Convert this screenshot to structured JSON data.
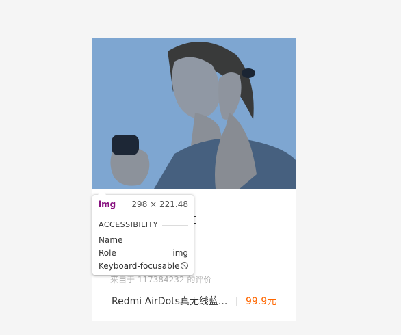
{
  "card": {
    "image_alt": "woman wearing Redmi AirDots earbuds",
    "review_text": "蓝牙可以说秒连。红",
    "author_text": "来自于 117384232 的评价",
    "product_name": "Redmi AirDots真无线蓝...",
    "price": "99.9元"
  },
  "tooltip": {
    "tag": "img",
    "dimensions": "298 × 221.48",
    "section_title": "ACCESSIBILITY",
    "rows": [
      {
        "label": "Name",
        "value": ""
      },
      {
        "label": "Role",
        "value": "img"
      },
      {
        "label": "Keyboard-focusable",
        "value": ""
      }
    ],
    "keyboard_icon": "not-allowed-icon"
  },
  "colors": {
    "background": "#f5f5f5",
    "price": "#ff6700",
    "tag": "#881280",
    "highlight": "#6fa8dc"
  }
}
